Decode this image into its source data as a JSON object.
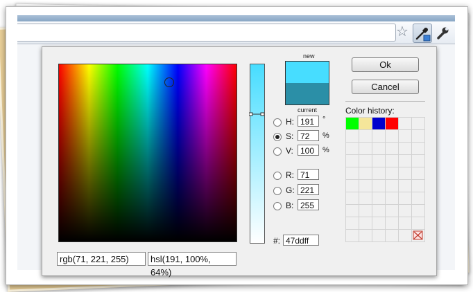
{
  "picker": {
    "preview": {
      "new_label": "new",
      "current_label": "current",
      "new_color": "#47ddff",
      "current_color": "#2b8fa7"
    },
    "hsv": {
      "h": {
        "label": "H:",
        "value": "191",
        "unit": "°",
        "selected": false
      },
      "s": {
        "label": "S:",
        "value": "72",
        "unit": "%",
        "selected": true
      },
      "v": {
        "label": "V:",
        "value": "100",
        "unit": "%",
        "selected": false
      }
    },
    "rgb": {
      "r": {
        "label": "R:",
        "value": "71"
      },
      "g": {
        "label": "G:",
        "value": "221"
      },
      "b": {
        "label": "B:",
        "value": "255"
      }
    },
    "hex": {
      "label": "#:",
      "value": "47ddff"
    },
    "buttons": {
      "ok": "Ok",
      "cancel": "Cancel"
    },
    "history": {
      "label": "Color history:",
      "colors": [
        "#00ff00",
        "#f5e69a",
        "#0000cc",
        "#ff0000"
      ],
      "clear_icon": "clear-history-icon"
    },
    "rgb_text": "rgb(71, 221, 255)",
    "hsl_text": "hsl(191, 100%, 64%)"
  },
  "toolbar": {
    "icons": [
      "star-icon",
      "eyedropper-icon",
      "wrench-icon"
    ]
  }
}
